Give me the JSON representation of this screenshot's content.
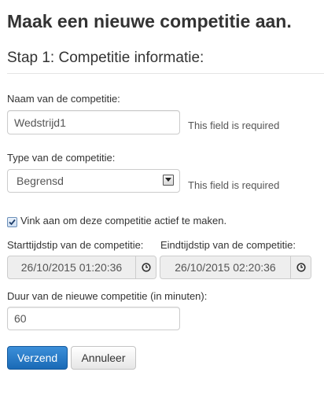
{
  "page": {
    "title": "Maak een nieuwe competitie aan.",
    "step_title": "Stap 1: Competitie informatie:"
  },
  "form": {
    "name": {
      "label": "Naam van de competitie:",
      "value": "Wedstrijd1",
      "help": "This field is required"
    },
    "type": {
      "label": "Type van de competitie:",
      "selected": "Begrensd",
      "help": "This field is required"
    },
    "active": {
      "label": "Vink aan om deze competitie actief te maken.",
      "checked": true
    },
    "start": {
      "label": "Starttijdstip van de competitie:",
      "value": "26/10/2015 01:20:36",
      "icon": "clock-icon"
    },
    "end": {
      "label": "Eindtijdstip van de competitie:",
      "value": "26/10/2015 02:20:36",
      "icon": "clock-icon"
    },
    "duration": {
      "label": "Duur van de nieuwe competitie (in minuten):",
      "value": "60"
    }
  },
  "buttons": {
    "submit": "Verzend",
    "cancel": "Annuleer"
  },
  "colors": {
    "primary": "#2a7bc8",
    "text": "#333333",
    "border": "#cccccc",
    "disabled_bg": "#eeeeee"
  }
}
